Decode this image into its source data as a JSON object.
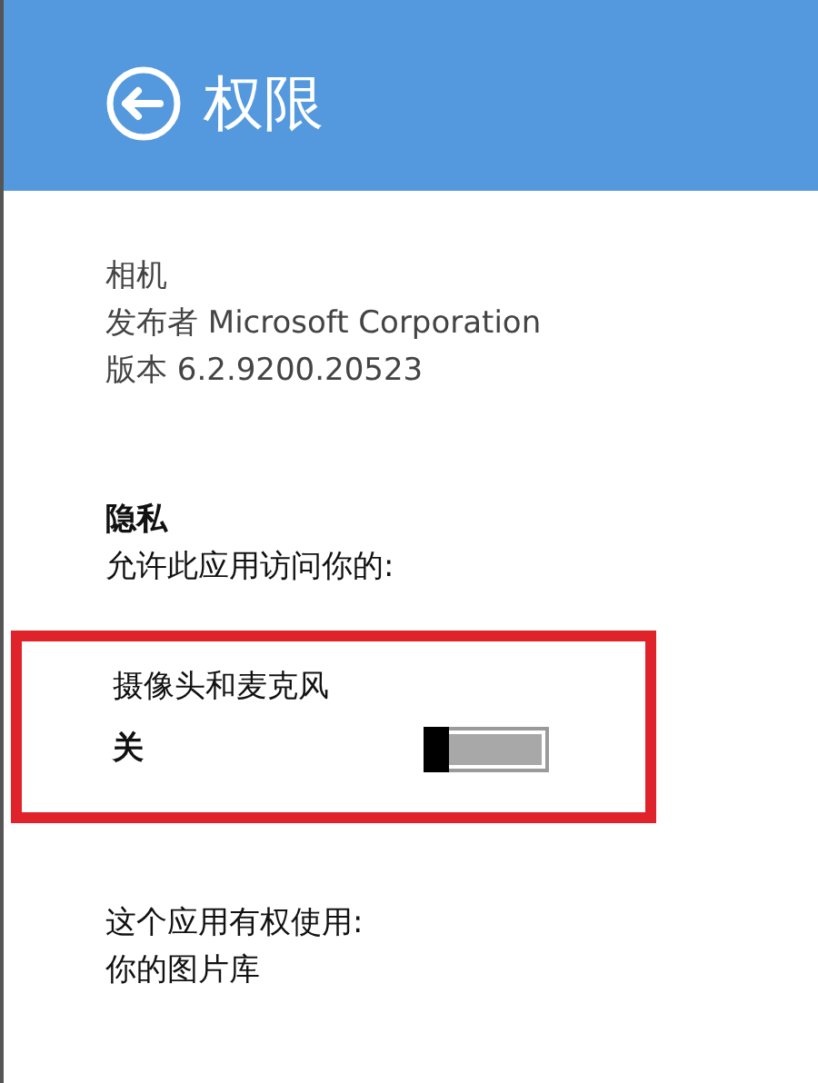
{
  "header": {
    "title": "权限"
  },
  "app_info": [
    "相机",
    "发布者 Microsoft Corporation",
    "版本 6.2.9200.20523"
  ],
  "privacy": {
    "heading": "隐私",
    "description": "允许此应用访问你的:"
  },
  "permission": {
    "label": "摄像头和麦克风",
    "state_text": "关",
    "on": false,
    "highlighted": true
  },
  "capabilities": {
    "heading": "这个应用有权使用:",
    "items": [
      "你的图片库"
    ]
  }
}
